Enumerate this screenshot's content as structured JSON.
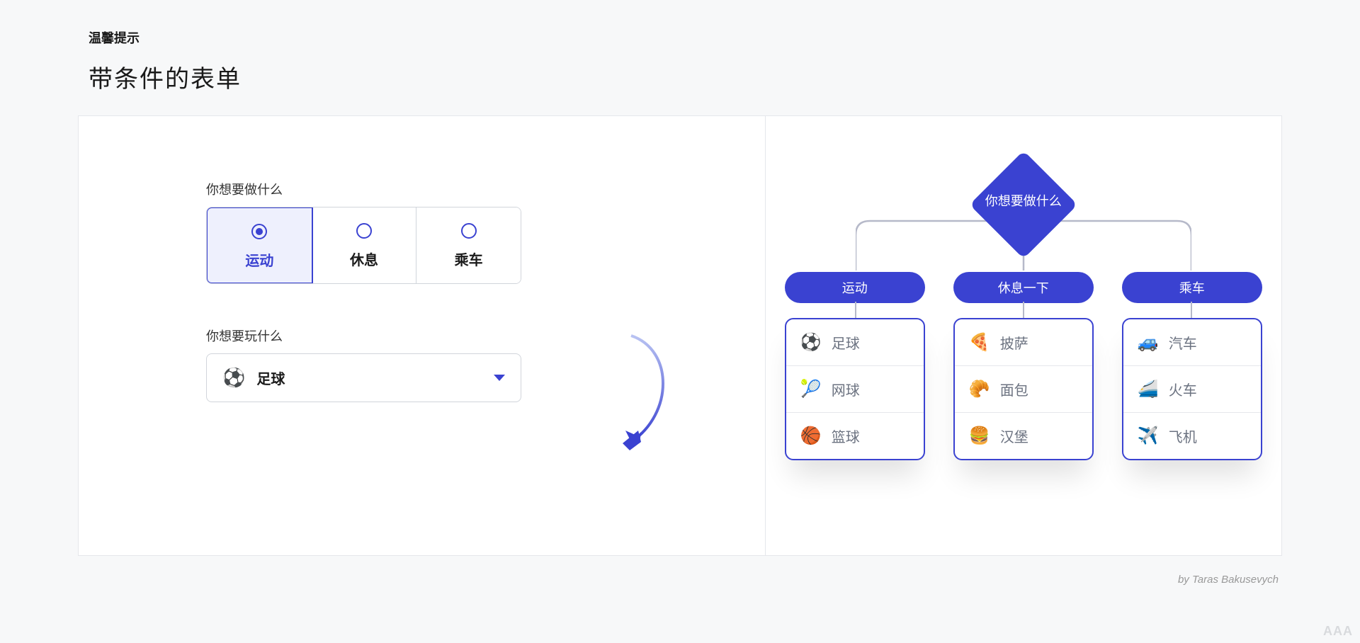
{
  "header": {
    "tag": "温馨提示",
    "title": "带条件的表单"
  },
  "form": {
    "question1": "你想要做什么",
    "options": [
      {
        "label": "运动",
        "selected": true
      },
      {
        "label": "休息",
        "selected": false
      },
      {
        "label": "乘车",
        "selected": false
      }
    ],
    "question2": "你想要玩什么",
    "dropdown": {
      "icon": "⚽",
      "value": "足球"
    }
  },
  "diagram": {
    "root": "你想要做什么",
    "branches": [
      {
        "label": "运动",
        "items": [
          {
            "icon": "⚽",
            "text": "足球"
          },
          {
            "icon": "🎾",
            "text": "网球"
          },
          {
            "icon": "🏀",
            "text": "篮球"
          }
        ]
      },
      {
        "label": "休息一下",
        "items": [
          {
            "icon": "🍕",
            "text": "披萨"
          },
          {
            "icon": "🥐",
            "text": "面包"
          },
          {
            "icon": "🍔",
            "text": "汉堡"
          }
        ]
      },
      {
        "label": "乘车",
        "items": [
          {
            "icon": "🚙",
            "text": "汽车"
          },
          {
            "icon": "🚄",
            "text": "火车"
          },
          {
            "icon": "✈️",
            "text": "飞机"
          }
        ]
      }
    ]
  },
  "footer": {
    "credit": "by Taras Bakusevych"
  },
  "watermark": "AAA"
}
